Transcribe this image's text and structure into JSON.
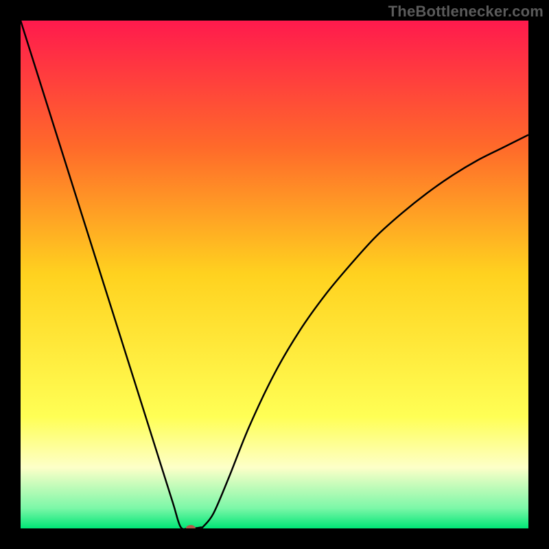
{
  "watermark": "TheBottlenecker.com",
  "chart_data": {
    "type": "line",
    "title": "",
    "xlabel": "",
    "ylabel": "",
    "xlim": [
      0,
      100
    ],
    "ylim": [
      0,
      100
    ],
    "grid": false,
    "legend": false,
    "background_gradient": {
      "stops": [
        {
          "y": 0,
          "color": "#ff1a4d"
        },
        {
          "y": 25,
          "color": "#ff6a2a"
        },
        {
          "y": 50,
          "color": "#ffd21f"
        },
        {
          "y": 78,
          "color": "#ffff55"
        },
        {
          "y": 88,
          "color": "#fdffc8"
        },
        {
          "y": 96,
          "color": "#7cf7a8"
        },
        {
          "y": 100,
          "color": "#00e676"
        }
      ]
    },
    "series": [
      {
        "name": "bottleneck-curve",
        "color": "#000000",
        "x": [
          0,
          3,
          6,
          9,
          12,
          15,
          18,
          21,
          24,
          27,
          30,
          31.5,
          33,
          34,
          35.5,
          36,
          38,
          41,
          45,
          50,
          55,
          60,
          65,
          70,
          75,
          80,
          85,
          90,
          95,
          100
        ],
        "y": [
          100,
          90.5,
          81,
          71.5,
          62,
          52.5,
          43,
          33.5,
          24,
          14.5,
          5,
          0.3,
          0,
          0,
          0.2,
          0.4,
          3,
          10,
          20,
          30.5,
          39,
          46,
          52,
          57.5,
          62,
          66,
          69.5,
          72.5,
          75,
          77.5
        ]
      }
    ],
    "marker": {
      "name": "min-point",
      "x": 33.5,
      "y": 0,
      "color": "#b35a4a",
      "rx": 7,
      "ry": 5
    }
  }
}
